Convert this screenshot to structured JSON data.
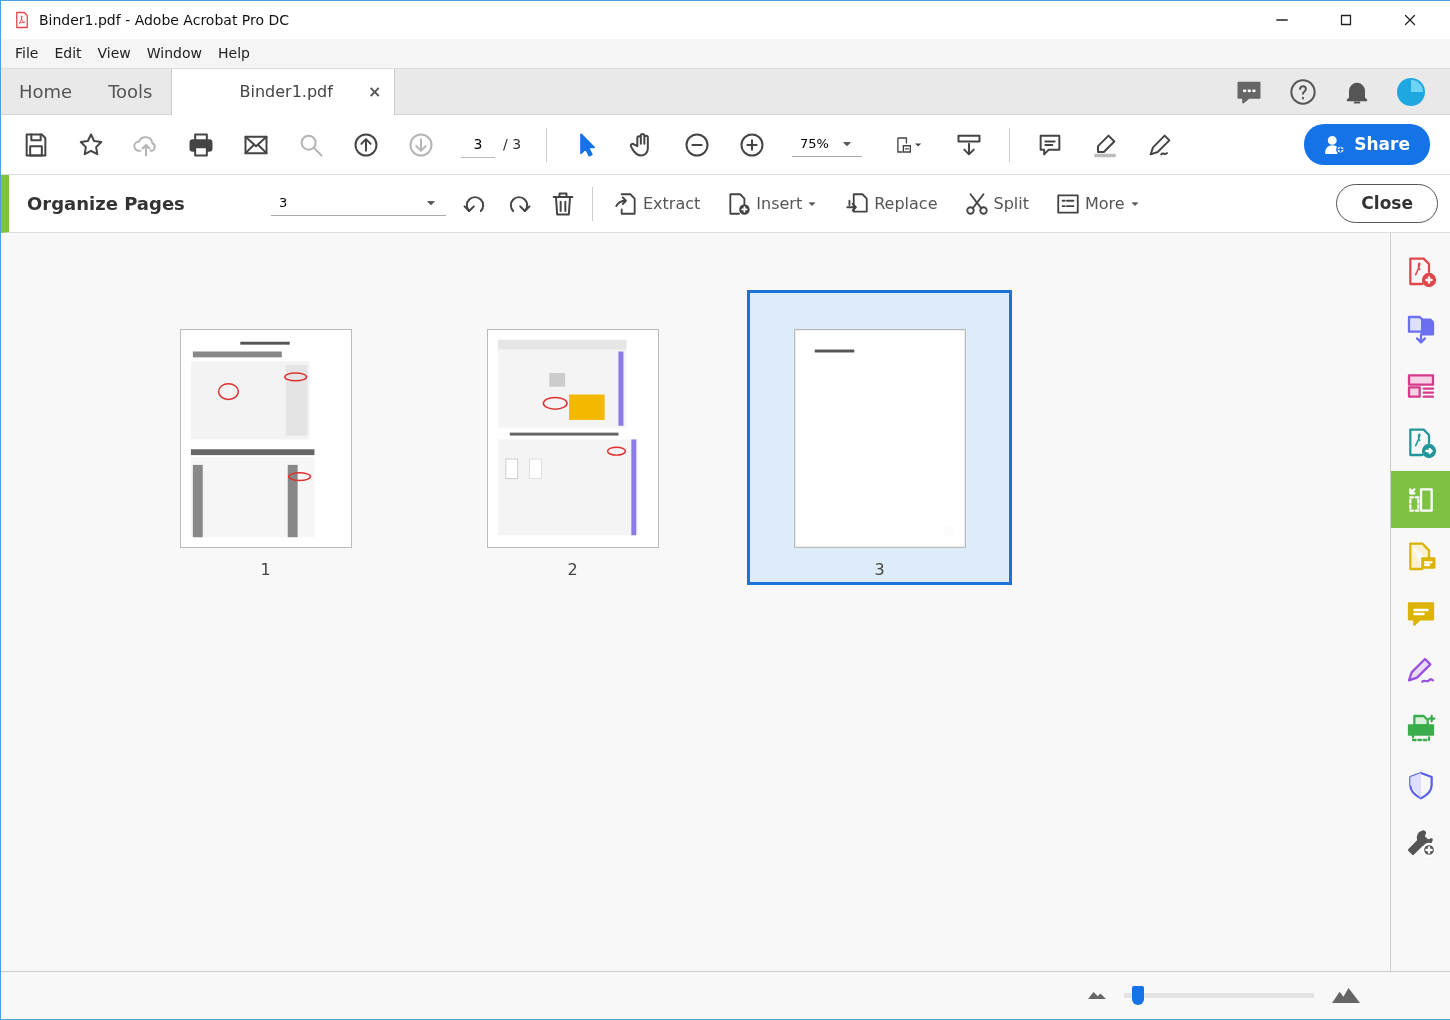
{
  "window": {
    "title": "Binder1.pdf - Adobe Acrobat Pro DC"
  },
  "menu": [
    "File",
    "Edit",
    "View",
    "Window",
    "Help"
  ],
  "tabs": [
    {
      "label": "Home",
      "selected": false
    },
    {
      "label": "Tools",
      "selected": false
    },
    {
      "label": "Binder1.pdf",
      "selected": true,
      "close": "×"
    }
  ],
  "toolbar": {
    "tools": [
      {
        "kind": "save",
        "disabled": false,
        "selected": false
      },
      {
        "kind": "star",
        "disabled": false,
        "selected": false
      },
      {
        "kind": "upload",
        "disabled": true,
        "selected": false
      },
      {
        "kind": "print",
        "disabled": false,
        "selected": false
      },
      {
        "kind": "mail",
        "disabled": false,
        "selected": false
      },
      {
        "kind": "marquee-zoom",
        "disabled": true,
        "selected": false
      },
      {
        "kind": "prev-page",
        "disabled": false,
        "selected": false
      },
      {
        "kind": "next-page",
        "disabled": true,
        "selected": false
      }
    ],
    "page_current": "3",
    "page_total": "/ 3",
    "view_tools": [
      {
        "kind": "pointer",
        "disabled": false,
        "selected": true
      },
      {
        "kind": "hand",
        "disabled": false,
        "selected": false
      },
      {
        "kind": "zoom-out",
        "disabled": false,
        "selected": false
      },
      {
        "kind": "zoom-in",
        "disabled": false,
        "selected": false
      }
    ],
    "zoom": "75%",
    "share": "Share"
  },
  "organize": {
    "title": "Organize Pages",
    "page_select": "3",
    "close": "Close",
    "actions": [
      {
        "kind": "extract",
        "label": "Extract",
        "dropdown": false
      },
      {
        "kind": "insert",
        "label": "Insert",
        "dropdown": true
      },
      {
        "kind": "replace",
        "label": "Replace",
        "dropdown": false
      },
      {
        "kind": "split",
        "label": "Split",
        "dropdown": false
      },
      {
        "kind": "more",
        "label": "More",
        "dropdown": true
      }
    ]
  },
  "pages": [
    {
      "number": "1",
      "selected": false
    },
    {
      "number": "2",
      "selected": false
    },
    {
      "number": "3",
      "selected": true
    }
  ],
  "sidebar": [
    {
      "kind": "create-pdf",
      "color": "#e0474c",
      "selected": false
    },
    {
      "kind": "combine",
      "color": "#6b6ff0",
      "selected": false
    },
    {
      "kind": "organize-layout",
      "color": "#d63a8a",
      "selected": false
    },
    {
      "kind": "export",
      "color": "#23989a",
      "selected": false
    },
    {
      "kind": "organize-pages",
      "color": "#7dc243",
      "selected": true
    },
    {
      "kind": "edit-doc",
      "color": "#dcb400",
      "selected": false
    },
    {
      "kind": "comment",
      "color": "#dcb400",
      "selected": false
    },
    {
      "kind": "fill-sign",
      "color": "#9b4fe0",
      "selected": false
    },
    {
      "kind": "scan",
      "color": "#3aac4c",
      "selected": false
    },
    {
      "kind": "protect",
      "color": "#5961e8",
      "selected": false
    },
    {
      "kind": "more-tools",
      "color": "#555555",
      "selected": false
    }
  ],
  "zoom_slider": {
    "level": 0.04
  }
}
